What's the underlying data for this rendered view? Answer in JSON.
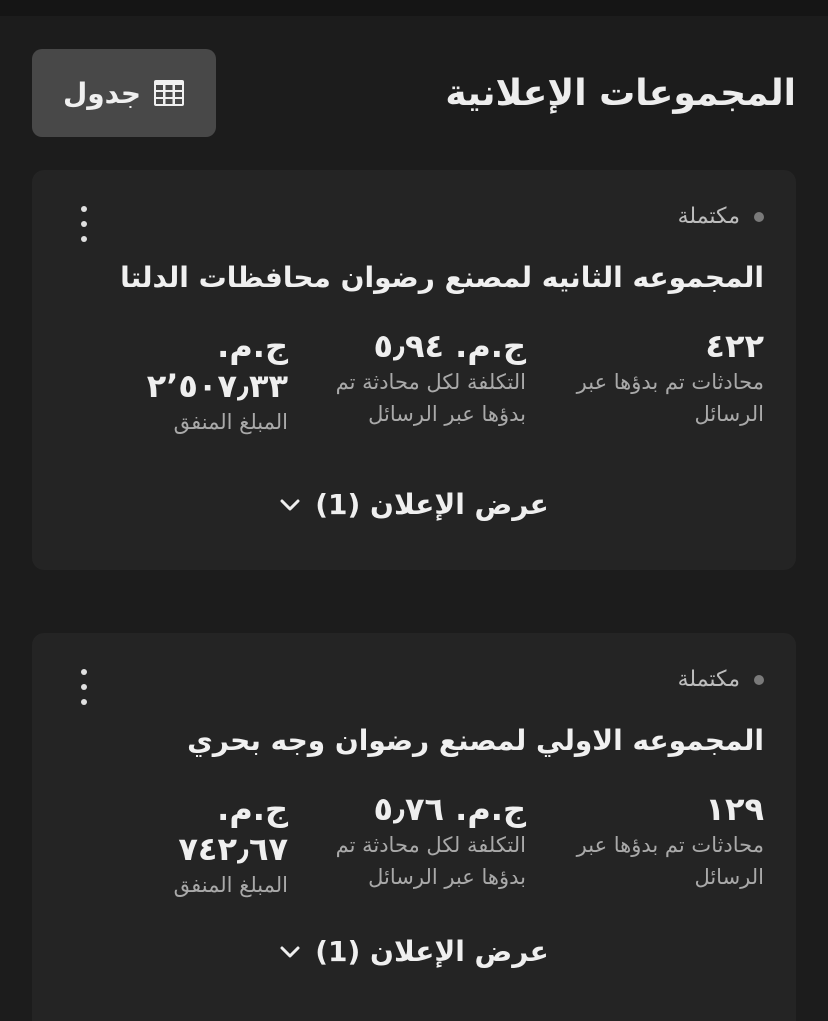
{
  "header": {
    "title": "المجموعات الإعلانية",
    "table_button_label": "جدول",
    "table_button_icon": "grid-table-icon"
  },
  "ad_groups": [
    {
      "status": "مكتملة",
      "name": "المجموعه الثانيه لمصنع رضوان محافظات الدلتا",
      "metrics": [
        {
          "value": "٤٢٢",
          "caption": "محادثات تم بدؤها عبر الرسائل"
        },
        {
          "value": "ج.م. ٥٫٩٤",
          "caption": "التكلفة لكل محادثة تم بدؤها عبر الرسائل"
        },
        {
          "value": "ج.م. ٢٬٥٠٧٫٣٣",
          "caption": "المبلغ المنفق"
        }
      ],
      "view_ads_label": "عرض الإعلان (1)"
    },
    {
      "status": "مكتملة",
      "name": "المجموعه الاولي لمصنع رضوان وجه بحري",
      "metrics": [
        {
          "value": "١٢٩",
          "caption": "محادثات تم بدؤها عبر الرسائل"
        },
        {
          "value": "ج.م. ٥٫٧٦",
          "caption": "التكلفة لكل محادثة تم بدؤها عبر الرسائل"
        },
        {
          "value": "ج.م. ٧٤٢٫٦٧",
          "caption": "المبلغ المنفق"
        }
      ],
      "view_ads_label": "عرض الإعلان (1)"
    }
  ],
  "colors": {
    "background": "#1c1c1c",
    "card": "#242424",
    "button": "#484848",
    "status_dot": "#7a7a7a"
  }
}
